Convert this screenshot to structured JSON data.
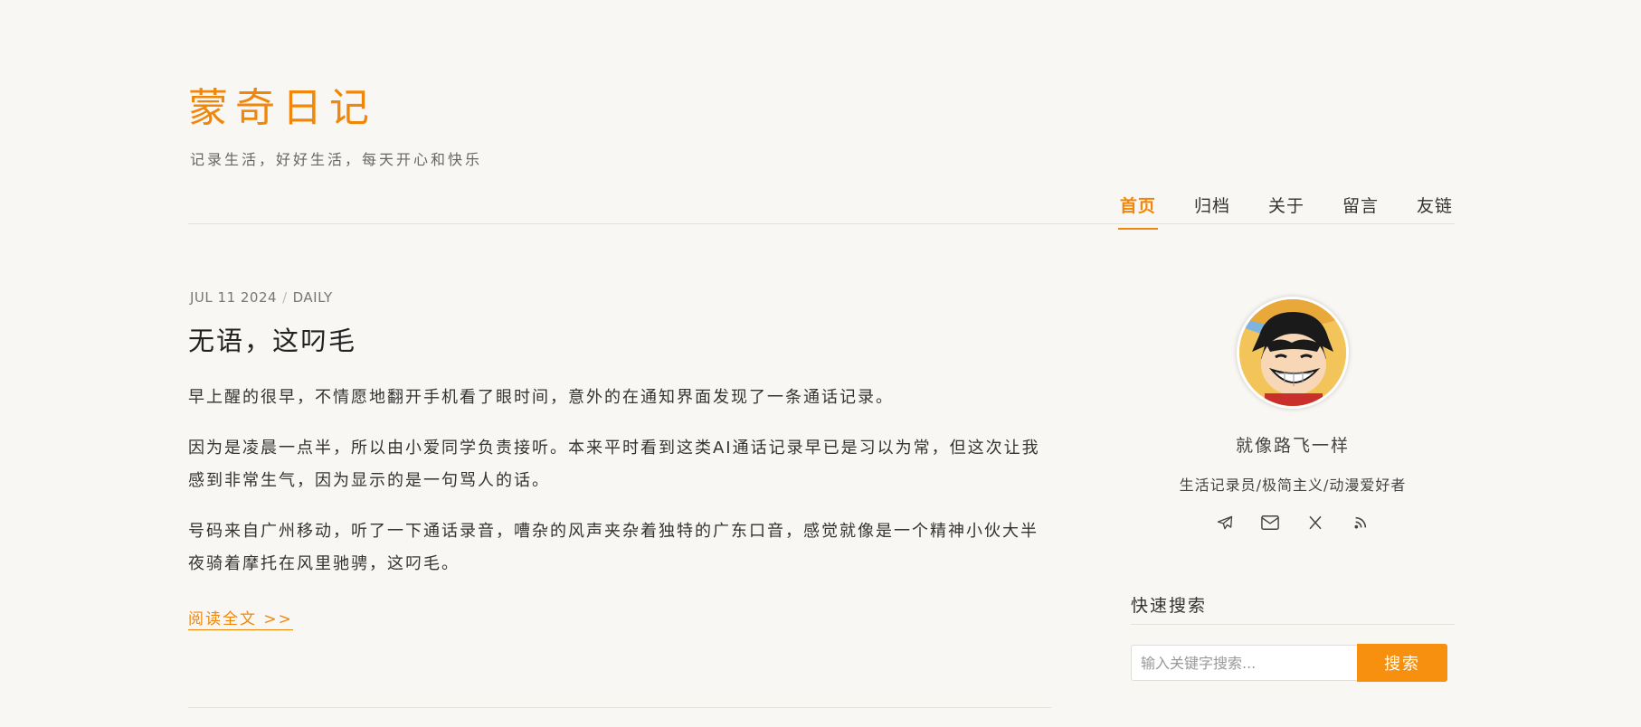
{
  "site": {
    "title": "蒙奇日记",
    "description": "记录生活，好好生活，每天开心和快乐"
  },
  "nav": {
    "items": [
      {
        "label": "首页",
        "active": true
      },
      {
        "label": "归档",
        "active": false
      },
      {
        "label": "关于",
        "active": false
      },
      {
        "label": "留言",
        "active": false
      },
      {
        "label": "友链",
        "active": false
      }
    ]
  },
  "post": {
    "date": "JUL 11 2024",
    "separator": "/",
    "category": "DAILY",
    "title": "无语，这叼毛",
    "paragraphs": [
      "早上醒的很早，不情愿地翻开手机看了眼时间，意外的在通知界面发现了一条通话记录。",
      "因为是凌晨一点半，所以由小爱同学负责接听。本来平时看到这类AI通话记录早已是习以为常，但这次让我感到非常生气，因为显示的是一句骂人的话。",
      "号码来自广州移动，听了一下通话录音，嘈杂的风声夹杂着独特的广东口音，感觉就像是一个精神小伙大半夜骑着摩托在风里驰骋，这叼毛。"
    ],
    "read_more": "阅读全文 >>"
  },
  "sidebar": {
    "author_name": "就像路飞一样",
    "author_bio": "生活记录员/极简主义/动漫爱好者",
    "social_icons": [
      "telegram-icon",
      "mail-icon",
      "x-icon",
      "rss-icon"
    ],
    "search": {
      "title": "快速搜索",
      "placeholder": "输入关键字搜索...",
      "button": "搜索"
    }
  },
  "colors": {
    "accent": "#f0870a",
    "background": "#f9f7f3",
    "text": "#333333"
  }
}
